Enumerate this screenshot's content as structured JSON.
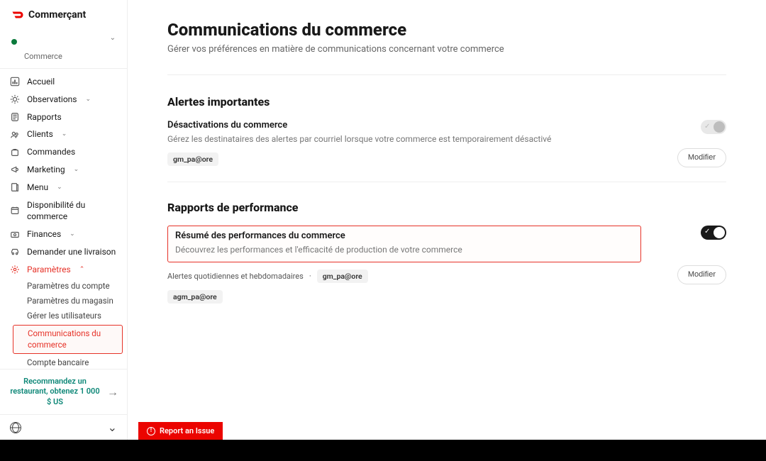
{
  "brand": {
    "name": "Commerçant"
  },
  "org": {
    "label": "Commerce"
  },
  "nav": {
    "home": "Accueil",
    "observations": "Observations",
    "reports": "Rapports",
    "clients": "Clients",
    "orders": "Commandes",
    "marketing": "Marketing",
    "menu": "Menu",
    "availability": "Disponibilité du commerce",
    "finances": "Finances",
    "request_delivery": "Demander une livraison",
    "settings": "Paramètres",
    "sub": {
      "account": "Paramètres du compte",
      "store": "Paramètres du magasin",
      "users": "Gérer les utilisateurs",
      "comms": "Communications du commerce",
      "bank": "Compte bancaire"
    }
  },
  "referral": {
    "text": "Recommandez un restaurant, obtenez 1 000 $ US"
  },
  "page": {
    "title": "Communications du commerce",
    "subtitle": "Gérer vos préférences en matière de communications concernant votre commerce"
  },
  "alerts": {
    "section_title": "Alertes importantes",
    "deact_label": "Désactivations du commerce",
    "deact_desc": "Gérez les destinataires des alertes par courriel lorsque votre commerce est temporairement désactivé",
    "chip1": "gm_pa@ore",
    "modify": "Modifier"
  },
  "perf": {
    "section_title": "Rapports de performance",
    "summary_label": "Résumé des performances du commerce",
    "summary_desc": "Découvrez les performances et l'efficacité de production de votre commerce",
    "daily_label": "Alertes quotidiennes et hebdomadaires",
    "sep": "·",
    "chip1": "gm_pa@ore",
    "chip2": "agm_pa@ore",
    "modify": "Modifier"
  },
  "report_issue": "Report an Issue"
}
